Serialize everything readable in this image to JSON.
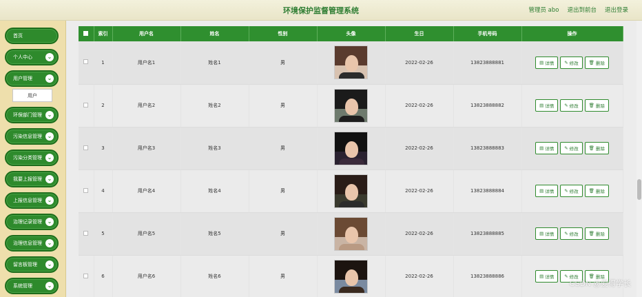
{
  "header": {
    "title": "环境保护监督管理系统",
    "admin": "管理员 abo",
    "front": "退出到前台",
    "logout": "退出登录"
  },
  "sidebar": {
    "items": [
      {
        "label": "首页",
        "chevron": false
      },
      {
        "label": "个人中心",
        "chevron": true
      },
      {
        "label": "用户管理",
        "chevron": true
      },
      {
        "label": "环保部门管理",
        "chevron": true
      },
      {
        "label": "污染信息管理",
        "chevron": true
      },
      {
        "label": "污染分类管理",
        "chevron": true
      },
      {
        "label": "我要上报管理",
        "chevron": true
      },
      {
        "label": "上报信息管理",
        "chevron": true
      },
      {
        "label": "治理记录管理",
        "chevron": true
      },
      {
        "label": "治理信息管理",
        "chevron": true
      },
      {
        "label": "留言板管理",
        "chevron": true
      },
      {
        "label": "系统管理",
        "chevron": true
      }
    ],
    "sub_item": "用户"
  },
  "table": {
    "headers": [
      "",
      "索引",
      "用户名",
      "姓名",
      "性别",
      "头像",
      "生日",
      "手机号码",
      "操作"
    ],
    "rows": [
      {
        "index": "1",
        "username": "用户名1",
        "name": "姓名1",
        "gender": "男",
        "birthday": "2022-02-26",
        "phone": "13823888881"
      },
      {
        "index": "2",
        "username": "用户名2",
        "name": "姓名2",
        "gender": "男",
        "birthday": "2022-02-26",
        "phone": "13823888882"
      },
      {
        "index": "3",
        "username": "用户名3",
        "name": "姓名3",
        "gender": "男",
        "birthday": "2022-02-26",
        "phone": "13823888883"
      },
      {
        "index": "4",
        "username": "用户名4",
        "name": "姓名4",
        "gender": "男",
        "birthday": "2022-02-26",
        "phone": "13823888884"
      },
      {
        "index": "5",
        "username": "用户名5",
        "name": "姓名5",
        "gender": "男",
        "birthday": "2022-02-26",
        "phone": "13823888885"
      },
      {
        "index": "6",
        "username": "用户名6",
        "name": "姓名6",
        "gender": "男",
        "birthday": "2022-02-26",
        "phone": "13823888886"
      }
    ],
    "ops": {
      "detail": "详情",
      "edit": "修改",
      "delete": "删除"
    }
  },
  "watermark": "CSDN @爱得学长",
  "colors": {
    "primary": "#2f8f2f",
    "sidebar_bg": "#eedfac",
    "header_bg": "#f3f1dc"
  }
}
